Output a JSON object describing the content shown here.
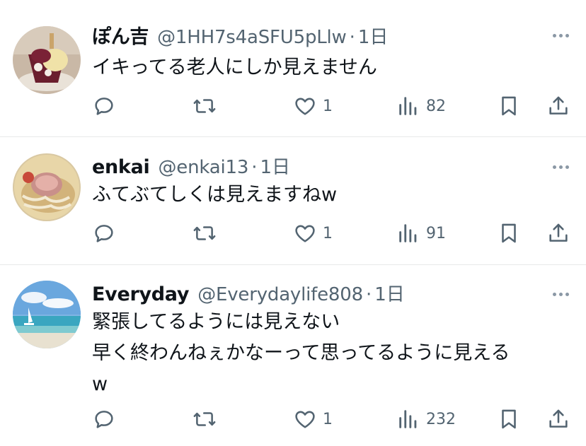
{
  "tweets": [
    {
      "name": "ぽん吉",
      "handle": "@1HH7s4aSFU5pLlw",
      "sep": "·",
      "time": "1日",
      "lines": [
        "イキってる老人にしか見えません"
      ],
      "likes": "1",
      "views": "82",
      "avatar_icon": "parfait-avatar"
    },
    {
      "name": "enkai",
      "handle": "@enkai13",
      "sep": "·",
      "time": "1日",
      "lines": [
        "ふてぶてしくは見えますねw"
      ],
      "likes": "1",
      "views": "91",
      "avatar_icon": "ramen-avatar"
    },
    {
      "name": "Everyday",
      "handle": "@Everydaylife808",
      "sep": "·",
      "time": "1日",
      "lines": [
        "緊張してるようには見えない",
        "早く終わんねぇかなーって思ってるように見える",
        "w"
      ],
      "likes": "1",
      "views": "232",
      "avatar_icon": "beach-avatar"
    }
  ],
  "colors": {
    "text": "#0f1419",
    "secondary": "#536471",
    "icon": "#536471",
    "divider": "#e7e9ea"
  }
}
